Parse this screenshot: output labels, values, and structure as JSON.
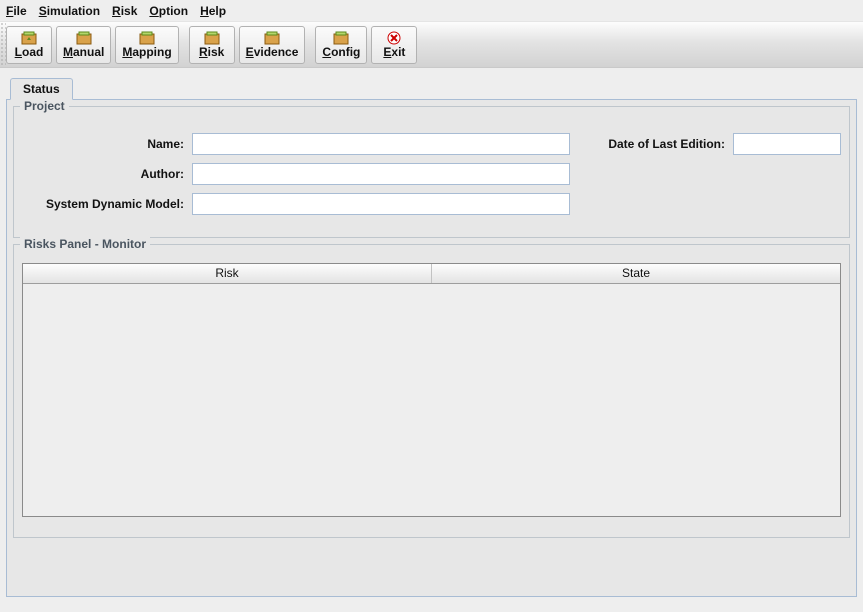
{
  "menu": {
    "items": [
      {
        "letter": "F",
        "rest": "ile"
      },
      {
        "letter": "S",
        "rest": "imulation"
      },
      {
        "letter": "R",
        "rest": "isk"
      },
      {
        "letter": "O",
        "rest": "ption"
      },
      {
        "letter": "H",
        "rest": "elp"
      }
    ]
  },
  "toolbar": {
    "buttons": [
      {
        "letter": "L",
        "rest": "oad",
        "icon": "box-icon",
        "name": "load-button"
      },
      {
        "letter": "M",
        "rest": "anual",
        "icon": "box-icon",
        "name": "manual-button"
      },
      {
        "letter": "M",
        "rest": "apping",
        "icon": "box-icon",
        "name": "mapping-button"
      },
      {
        "letter": "R",
        "rest": "isk",
        "icon": "box-icon",
        "name": "risk-button"
      },
      {
        "letter": "E",
        "rest": "vidence",
        "icon": "box-icon",
        "name": "evidence-button"
      },
      {
        "letter": "C",
        "rest": "onfig",
        "icon": "box-icon",
        "name": "config-button"
      },
      {
        "letter": "E",
        "rest": "xit",
        "icon": "x-icon",
        "name": "exit-button"
      }
    ]
  },
  "tabs": {
    "status": "Status"
  },
  "project": {
    "legend": "Project",
    "name_label": "Name:",
    "name_value": "",
    "author_label": "Author:",
    "author_value": "",
    "sdm_label": "System Dynamic Model:",
    "sdm_value": "",
    "dle_label": "Date of Last Edition:",
    "dle_value": ""
  },
  "risks_panel": {
    "legend": "Risks Panel - Monitor",
    "columns": {
      "risk": "Risk",
      "state": "State"
    },
    "rows": []
  }
}
